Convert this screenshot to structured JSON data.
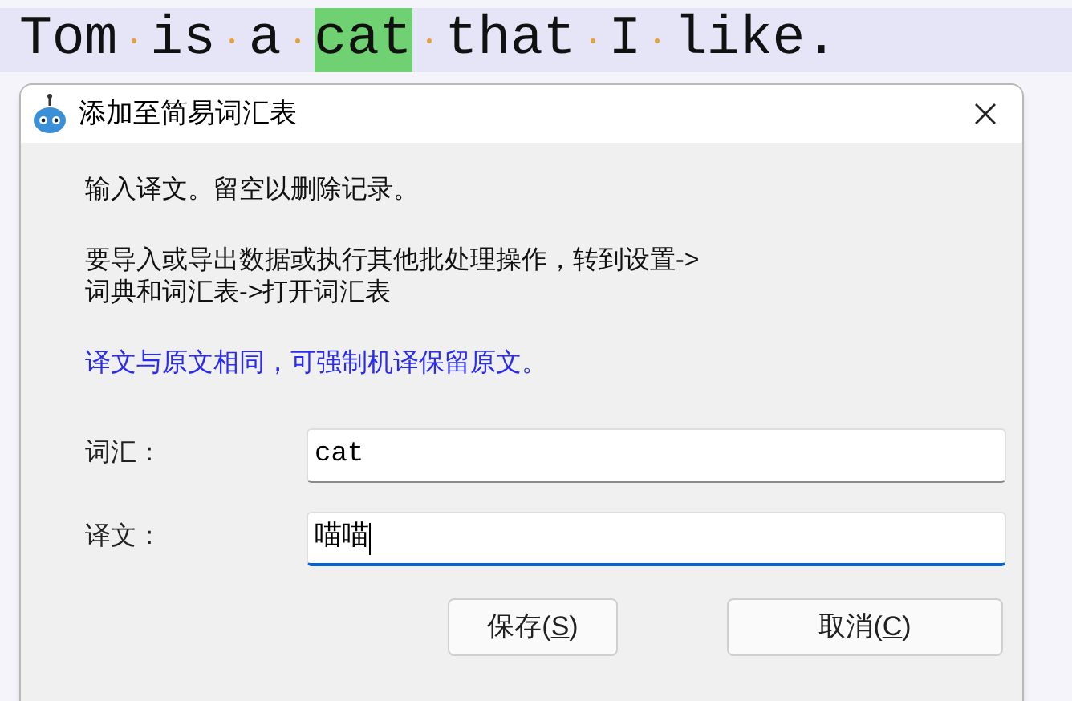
{
  "editor": {
    "words": [
      {
        "text": "Tom",
        "highlighted": false
      },
      {
        "text": "is",
        "highlighted": false
      },
      {
        "text": "a",
        "highlighted": false
      },
      {
        "text": "cat",
        "highlighted": true
      },
      {
        "text": "that",
        "highlighted": false
      },
      {
        "text": "I",
        "highlighted": false
      },
      {
        "text": "like.",
        "highlighted": false
      }
    ]
  },
  "dialog": {
    "title": "添加至简易词汇表",
    "messages": [
      {
        "text": "输入译文。留空以删除记录。",
        "kind": "normal"
      },
      {
        "text": "要导入或导出数据或执行其他批处理操作，转到设置->词典和词汇表->打开词汇表",
        "kind": "normal"
      },
      {
        "text": "译文与原文相同，可强制机译保留原文。",
        "kind": "hint"
      }
    ],
    "fields": [
      {
        "label": "词汇：",
        "value": "cat",
        "focused": false
      },
      {
        "label": "译文：",
        "value": "喵喵",
        "focused": true
      }
    ],
    "buttons": [
      {
        "label": "保存(",
        "mnemonic": "S",
        "suffix": ")"
      },
      {
        "label": "取消(",
        "mnemonic": "C",
        "suffix": ")"
      }
    ]
  }
}
